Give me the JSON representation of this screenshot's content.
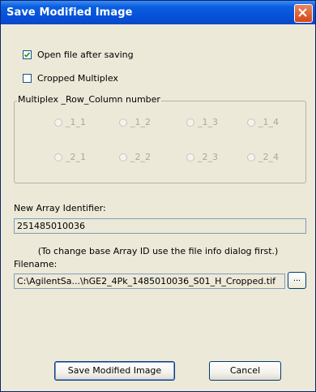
{
  "window": {
    "title": "Save Modified Image"
  },
  "options": {
    "open_after_saving": {
      "label": "Open file after saving",
      "checked": true
    },
    "cropped_multiplex": {
      "label": "Cropped Multiplex",
      "checked": false
    }
  },
  "multiplex": {
    "caption": "Multiplex _Row_Column number",
    "row1": [
      "_1_1",
      "_1_2",
      "_1_3",
      "_1_4"
    ],
    "row2": [
      "_2_1",
      "_2_2",
      "_2_3",
      "_2_4"
    ]
  },
  "array_identifier": {
    "label": "New Array Identifier:",
    "value": "251485010036",
    "note": "(To change base Array ID use the file info dialog first.)"
  },
  "filename": {
    "label": "Filename:",
    "value": "C:\\AgilentSa...\\hGE2_4Pk_1485010036_S01_H_Cropped.tif",
    "browse_label": "..."
  },
  "buttons": {
    "save": "Save Modified Image",
    "cancel": "Cancel"
  },
  "colors": {
    "titlebar": "#0a5fe0",
    "dialog_bg": "#ece9d8",
    "close_button": "#d54614"
  }
}
